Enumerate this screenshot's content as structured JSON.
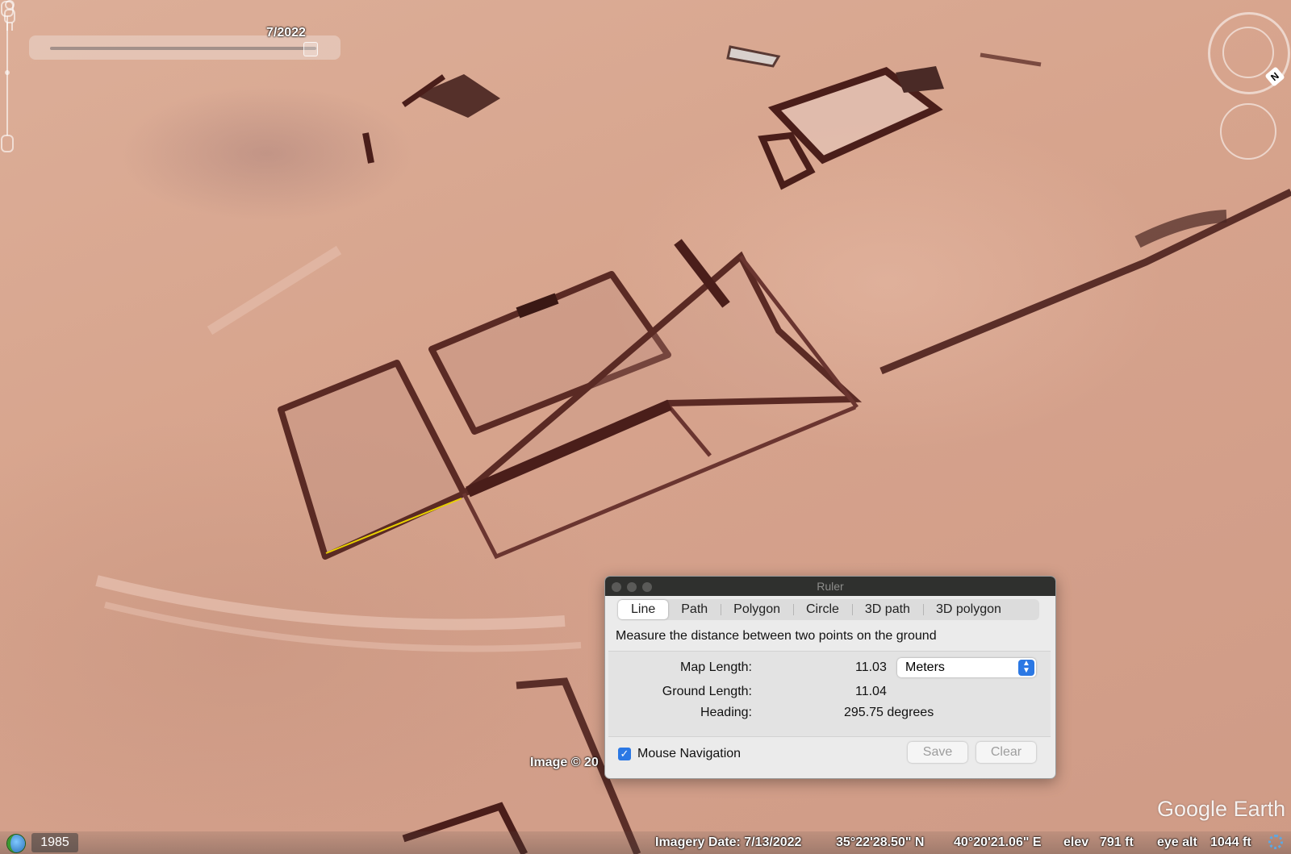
{
  "map": {
    "time_slider_label": "7/2022",
    "image_credit": "Image © 20",
    "logo_text": "Google Earth",
    "north_icon": "N"
  },
  "status_bar": {
    "year": "1985",
    "imagery_date": "Imagery Date: 7/13/2022",
    "latitude": "35°22'28.50\" N",
    "longitude": "40°20'21.06\" E",
    "elev_label": "elev",
    "elev_value": "791 ft",
    "eye_alt_label": "eye alt",
    "eye_alt_value": "1044 ft"
  },
  "ruler": {
    "title": "Ruler",
    "tabs": [
      {
        "label": "Line"
      },
      {
        "label": "Path"
      },
      {
        "label": "Polygon"
      },
      {
        "label": "Circle"
      },
      {
        "label": "3D path"
      },
      {
        "label": "3D polygon"
      }
    ],
    "active_tab": "Line",
    "description": "Measure the distance between two points on the ground",
    "map_length_label": "Map Length:",
    "map_length_value": "11.03",
    "units": "Meters",
    "ground_length_label": "Ground Length:",
    "ground_length_value": "11.04",
    "heading_label": "Heading:",
    "heading_value": "295.75 degrees",
    "mouse_navigation_label": "Mouse Navigation",
    "mouse_navigation_checked": true,
    "save_label": "Save",
    "clear_label": "Clear"
  },
  "colors": {
    "measure_line": "#e8d000",
    "accent": "#2b78e4",
    "ground": "#d7a48d"
  }
}
